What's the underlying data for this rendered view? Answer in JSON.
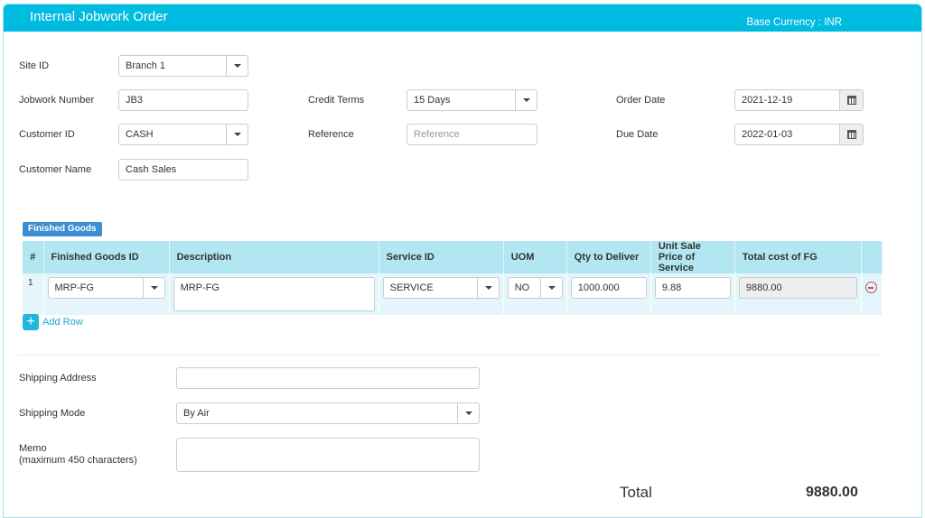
{
  "header": {
    "title": "Internal Jobwork Order",
    "base_currency": "Base Currency : INR"
  },
  "form": {
    "site_id": {
      "label": "Site ID",
      "value": "Branch 1"
    },
    "jobwork_number": {
      "label": "Jobwork Number",
      "value": "JB3"
    },
    "customer_id": {
      "label": "Customer ID",
      "value": "CASH"
    },
    "customer_name": {
      "label": "Customer Name",
      "value": "Cash Sales"
    },
    "credit_terms": {
      "label": "Credit Terms",
      "value": "15 Days"
    },
    "reference": {
      "label": "Reference",
      "value": "",
      "placeholder": "Reference"
    },
    "order_date": {
      "label": "Order Date",
      "value": "2021-12-19"
    },
    "due_date": {
      "label": "Due Date",
      "value": "2022-01-03"
    }
  },
  "finished_goods": {
    "badge": "Finished Goods",
    "columns": [
      "#",
      "Finished Goods ID",
      "Description",
      "Service ID",
      "UOM",
      "Qty to Deliver",
      "Unit Sale Price of Service",
      "Total cost of FG"
    ],
    "rows": [
      {
        "num": "1",
        "fg_id": "MRP-FG",
        "description": "MRP-FG",
        "service_id": "SERVICE",
        "uom": "NO",
        "qty": "1000.000",
        "unit_price": "9.88",
        "total": "9880.00"
      }
    ],
    "add_row_label": "Add Row"
  },
  "shipping": {
    "address": {
      "label": "Shipping Address",
      "value": ""
    },
    "mode": {
      "label": "Shipping Mode",
      "value": "By Air"
    },
    "memo": {
      "label": "Memo",
      "hint": "(maximum 450 characters)",
      "value": ""
    }
  },
  "summary": {
    "total_label": "Total",
    "total_value": "9880.00"
  }
}
